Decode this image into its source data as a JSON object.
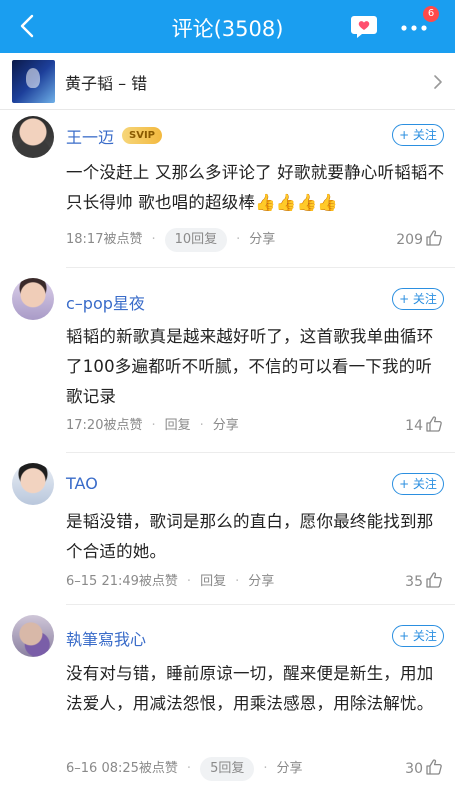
{
  "header": {
    "title": "评论(3508)",
    "badge_count": "6",
    "accent": "#1a9ef0"
  },
  "song": {
    "title": "黄子韬 – 错"
  },
  "follow_label": "+ 关注",
  "comments": [
    {
      "user": "王一迈",
      "vip": "SVIP",
      "text": "一个没赶上  又那么多评论了  好歌就要静心听韬韬不只长得帅  歌也唱的超级棒👍👍👍👍",
      "time": "18:17被点赞",
      "reply": "10回复",
      "share": "分享",
      "likes": "209"
    },
    {
      "user": "c–pop星夜",
      "text": "韬韬的新歌真是越来越好听了，这首歌我单曲循环了100多遍都听不听腻，不信的可以看一下我的听歌记录",
      "time": "17:20被点赞",
      "reply": "回复",
      "share": "分享",
      "likes": "14"
    },
    {
      "user": "TAO",
      "text": "是韬没错，歌词是那么的直白，愿你最终能找到那个合适的她。",
      "time": "6–15 21:49被点赞",
      "reply": "回复",
      "share": "分享",
      "likes": "35"
    },
    {
      "user": "執筆寫我心",
      "text": "没有对与错，睡前原谅一切，醒来便是新生，用加法爱人，用减法怨恨，用乘法感恩，用除法解忧。",
      "time": "6–16 08:25被点赞",
      "reply": "5回复",
      "share": "分享",
      "likes": "30"
    }
  ]
}
